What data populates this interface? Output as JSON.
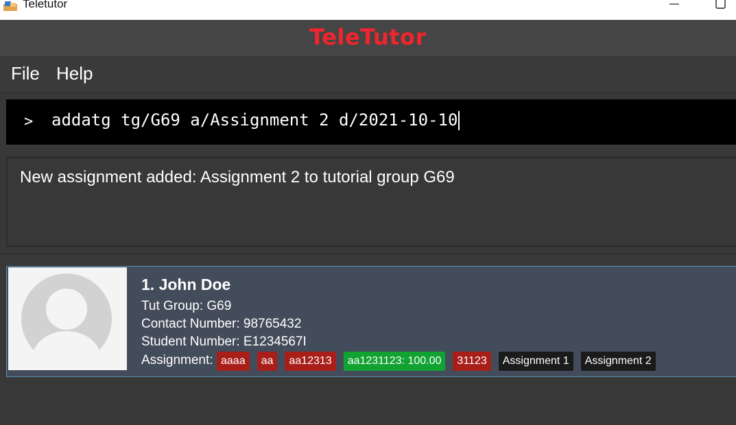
{
  "window": {
    "title": "Teletutor",
    "icon": "teletutor-app-icon",
    "minimize_icon": "minimize-icon",
    "maximize_icon": "maximize-icon"
  },
  "header": {
    "brand": "TeleTutor",
    "brand_color": "#f0252d"
  },
  "menu": {
    "file": "File",
    "help": "Help"
  },
  "command": {
    "prompt": ">",
    "value": "addatg tg/G69 a/Assignment 2 d/2021-10-10"
  },
  "result": {
    "message": "New assignment added: Assignment 2 to tutorial group G69"
  },
  "persons": [
    {
      "index_name": "1. John Doe",
      "tut_group": "Tut Group: G69",
      "contact": "Contact Number: 98765432",
      "student_number": "Student Number: E1234567I",
      "assignment_label": "Assignment:",
      "avatar_icon": "user-avatar-icon",
      "tags": [
        {
          "label": "aaaa",
          "color": "#a81f1a"
        },
        {
          "label": "aa",
          "color": "#a81f1a"
        },
        {
          "label": "aa12313",
          "color": "#a81f1a"
        },
        {
          "label": "aa1231123: 100.00",
          "color": "#11a232"
        },
        {
          "label": "31123",
          "color": "#a81f1a"
        },
        {
          "label": "Assignment 1",
          "color": "#1b1b1b"
        },
        {
          "label": "Assignment 2",
          "color": "#1b1b1b"
        }
      ]
    }
  ]
}
